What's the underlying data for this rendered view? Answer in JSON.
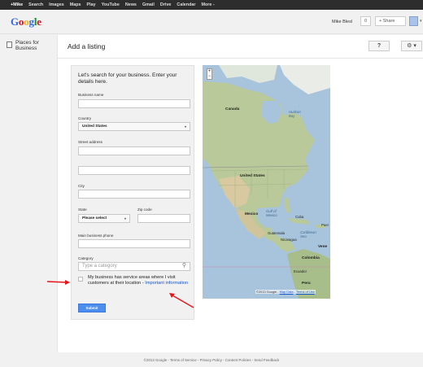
{
  "topbar": {
    "items": [
      "+Mike",
      "Search",
      "Images",
      "Maps",
      "Play",
      "YouTube",
      "News",
      "Gmail",
      "Drive",
      "Calendar",
      "More -"
    ]
  },
  "header": {
    "logo": "Google",
    "user_name": "Mike Blesl",
    "notifications_count": "0",
    "share_label": "+ Share",
    "caret": "▾"
  },
  "leftnav": {
    "item_label": "Places for Business"
  },
  "main": {
    "title": "Add a listing",
    "help_label": "?",
    "settings_label": "⚙ ▾"
  },
  "form": {
    "intro": "Let's search for your business. Enter your details here.",
    "business_name_label": "Business name",
    "business_name_value": "",
    "country_label": "Country",
    "country_value": "United States",
    "street_label": "Street address",
    "street_value": "",
    "street2_value": "",
    "city_label": "City",
    "city_value": "",
    "state_label": "State",
    "state_value": "Please select",
    "zip_label": "Zip code",
    "zip_value": "",
    "phone_label": "Main business phone",
    "phone_value": "",
    "category_label": "Category",
    "category_placeholder": "Type a category",
    "service_area_text": "My business has service areas where I visit customers at their location - ",
    "service_area_link": "Important information",
    "submit_label": "Submit"
  },
  "map": {
    "zoom_in": "+",
    "zoom_out": "−",
    "labels": {
      "canada": "Canada",
      "hudson_bay": "Hudson Bay",
      "united_states": "United States",
      "mexico": "Mexico",
      "gulf": "Gulf of Mexico",
      "cuba": "Cuba",
      "puerto": "Puer",
      "guatemala": "Guatemala",
      "nicaragua": "Nicaragua",
      "caribbean": "Caribbean Sea",
      "venezuela": "Vene",
      "colombia": "Colombia",
      "ecuador": "Ecuador",
      "peru": "Peru"
    },
    "footer_copy": "©2013 Google - ",
    "footer_mapdata": "Map Data",
    "footer_sep": " - ",
    "footer_terms": "Terms of Use"
  },
  "footer": {
    "text": "©2013 Google - Terms of Service - Privacy Policy - Content Policies - Send Feedback"
  },
  "colors": {
    "topbar": "#2d2d2d",
    "submit": "#4c8ef0",
    "link": "#1155cc",
    "annotation": "#e8141b",
    "water": "#a8c4dc"
  }
}
